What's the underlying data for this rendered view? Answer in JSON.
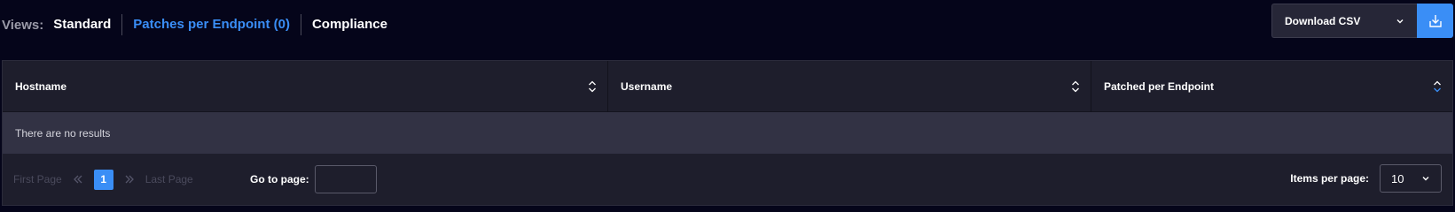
{
  "views": {
    "label": "Views:",
    "tabs": [
      {
        "label": "Standard",
        "active": false
      },
      {
        "label": "Patches per Endpoint (0)",
        "active": true
      },
      {
        "label": "Compliance",
        "active": false
      }
    ]
  },
  "download": {
    "label": "Download CSV",
    "icon": "download-icon"
  },
  "table": {
    "columns": [
      "Hostname",
      "Username",
      "Patched per Endpoint"
    ],
    "sorted_column": "Patched per Endpoint",
    "empty_message": "There are no results"
  },
  "pagination": {
    "first_page": "First Page",
    "last_page": "Last Page",
    "current_page": "1",
    "goto_label": "Go to page:",
    "goto_value": "",
    "items_per_page_label": "Items per page:",
    "items_per_page_value": "10"
  },
  "colors": {
    "background": "#05051a",
    "accent": "#3a8ef6",
    "header": "#1e1e2c",
    "empty_row": "#323244"
  }
}
